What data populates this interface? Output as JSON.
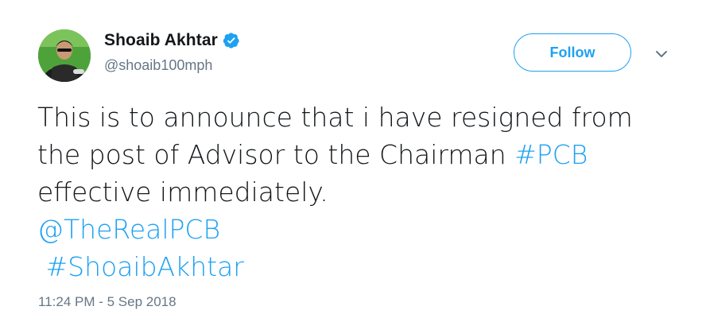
{
  "author": {
    "display_name": "Shoaib Akhtar",
    "handle": "@shoaib100mph",
    "verified": true,
    "avatar_icon": "avatar"
  },
  "actions": {
    "follow_label": "Follow",
    "more_icon": "chevron-down-icon"
  },
  "tweet": {
    "line1": "This is to announce that i have resigned from",
    "line2_text": "the post of Advisor to the Chairman ",
    "line2_hashtag": "#PCB",
    "line3": "effective immediately.",
    "mention": "@TheRealPCB",
    "hashtag": " #ShoaibAkhtar"
  },
  "timestamp": "11:24 PM - 5 Sep 2018",
  "colors": {
    "link": "#1da1f2",
    "text": "#14171a",
    "secondary": "#657786"
  }
}
